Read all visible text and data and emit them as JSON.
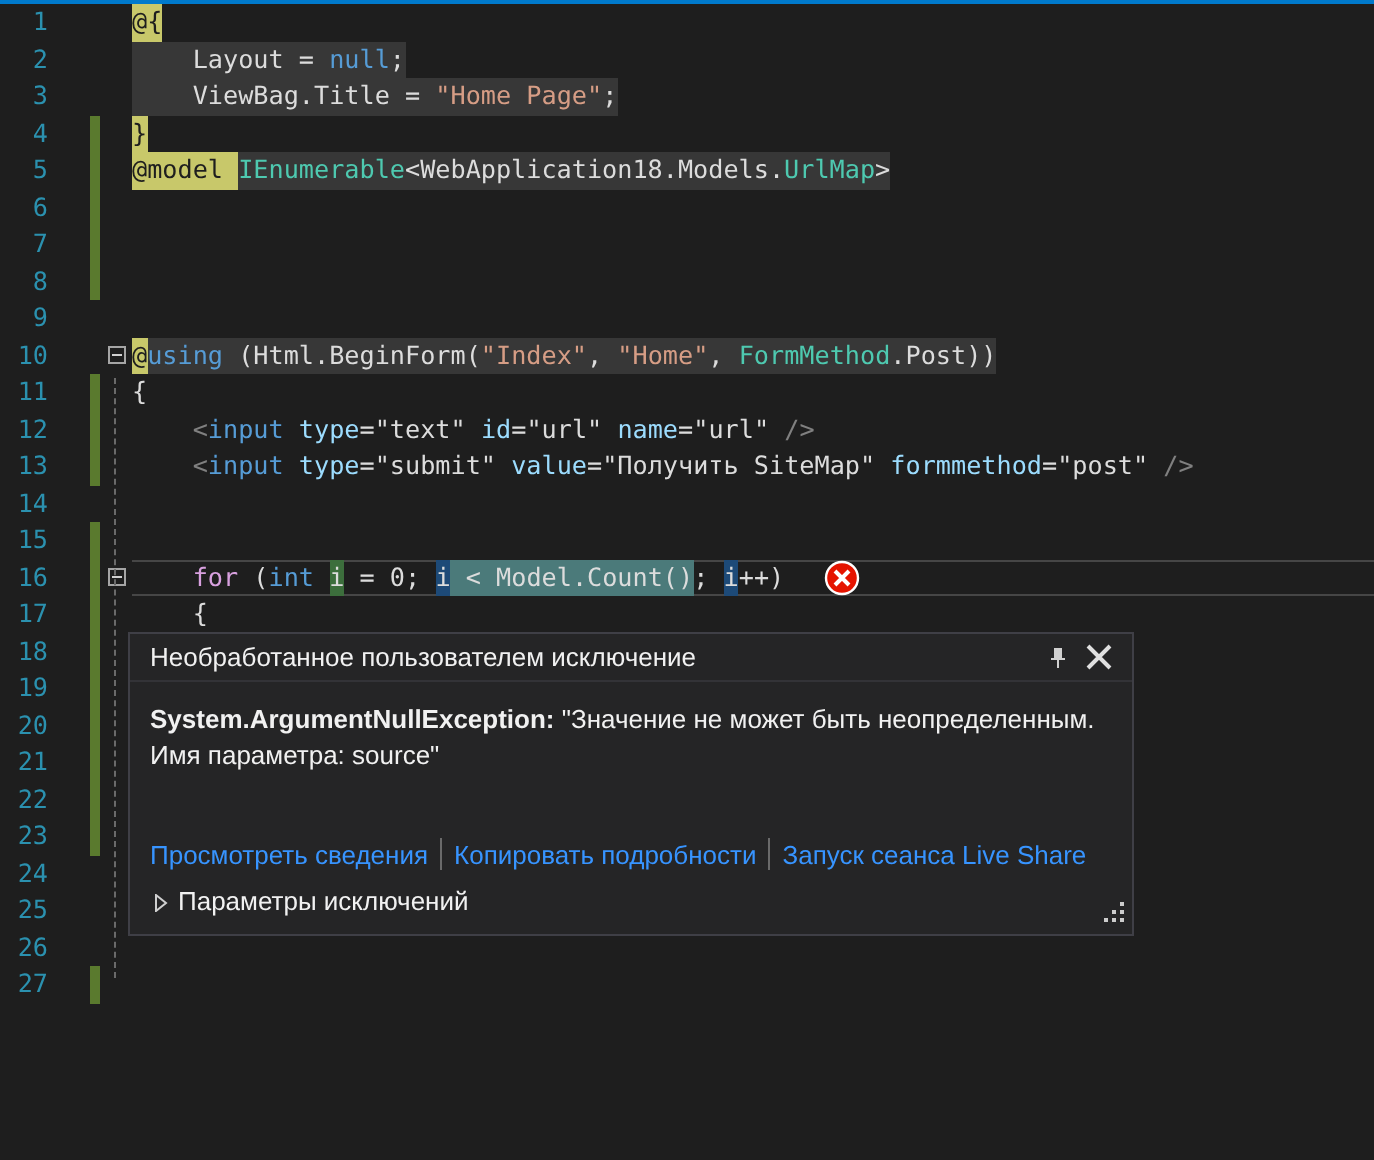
{
  "editor": {
    "lines": [
      {
        "number": "1",
        "modified": false,
        "fold": false,
        "current": false,
        "tokens": [
          {
            "text": "@{",
            "kind": "razor"
          }
        ]
      },
      {
        "number": "2",
        "modified": false,
        "fold": false,
        "current": false,
        "shaded": true,
        "tokens": [
          {
            "text": "    Layout = ",
            "kind": "plain"
          },
          {
            "text": "null",
            "kind": "keyword"
          },
          {
            "text": ";",
            "kind": "plain"
          }
        ]
      },
      {
        "number": "3",
        "modified": false,
        "fold": false,
        "current": false,
        "shaded": true,
        "tokens": [
          {
            "text": "    ViewBag.Title = ",
            "kind": "plain"
          },
          {
            "text": "\"Home Page\"",
            "kind": "string"
          },
          {
            "text": ";",
            "kind": "plain"
          }
        ]
      },
      {
        "number": "4",
        "modified": true,
        "fold": false,
        "current": false,
        "tokens": [
          {
            "text": "}",
            "kind": "razor"
          }
        ]
      },
      {
        "number": "5",
        "modified": true,
        "fold": false,
        "current": false,
        "shaded": true,
        "tokens": [
          {
            "text": "@model ",
            "kind": "razor"
          },
          {
            "text": "IEnumerable",
            "kind": "type"
          },
          {
            "text": "<WebApplication18.Models.",
            "kind": "plain"
          },
          {
            "text": "UrlMap",
            "kind": "type"
          },
          {
            "text": ">",
            "kind": "plain"
          }
        ]
      },
      {
        "number": "6",
        "modified": true,
        "fold": false,
        "current": false
      },
      {
        "number": "7",
        "modified": true,
        "fold": false,
        "current": false
      },
      {
        "number": "8",
        "modified": true,
        "fold": false,
        "current": false
      },
      {
        "number": "9",
        "modified": false,
        "fold": false,
        "current": false
      },
      {
        "number": "10",
        "modified": false,
        "fold": true,
        "current": false,
        "shaded": true,
        "tokens": [
          {
            "text": "@",
            "kind": "razor"
          },
          {
            "text": "using",
            "kind": "keyword"
          },
          {
            "text": " (Html.BeginForm(",
            "kind": "plain"
          },
          {
            "text": "\"Index\"",
            "kind": "string"
          },
          {
            "text": ", ",
            "kind": "plain"
          },
          {
            "text": "\"Home\"",
            "kind": "string"
          },
          {
            "text": ", ",
            "kind": "plain"
          },
          {
            "text": "FormMethod",
            "kind": "type"
          },
          {
            "text": ".Post))",
            "kind": "plain"
          }
        ]
      },
      {
        "number": "11",
        "modified": true,
        "fold": false,
        "current": false,
        "shaded": false,
        "tokens": [
          {
            "text": "{",
            "kind": "plain"
          }
        ]
      },
      {
        "number": "12",
        "modified": true,
        "fold": false,
        "current": false,
        "shaded": false,
        "tokens": [
          {
            "text": "    <",
            "kind": "tag"
          },
          {
            "text": "input ",
            "kind": "keyword"
          },
          {
            "text": "type",
            "kind": "attr"
          },
          {
            "text": "=\"text\" ",
            "kind": "plain"
          },
          {
            "text": "id",
            "kind": "attr"
          },
          {
            "text": "=\"url\" ",
            "kind": "plain"
          },
          {
            "text": "name",
            "kind": "attr"
          },
          {
            "text": "=\"url\" ",
            "kind": "plain"
          },
          {
            "text": "/>",
            "kind": "tag"
          }
        ]
      },
      {
        "number": "13",
        "modified": true,
        "fold": false,
        "current": false,
        "shaded": false,
        "tokens": [
          {
            "text": "    <",
            "kind": "tag"
          },
          {
            "text": "input ",
            "kind": "keyword"
          },
          {
            "text": "type",
            "kind": "attr"
          },
          {
            "text": "=\"submit\" ",
            "kind": "plain"
          },
          {
            "text": "value",
            "kind": "attr"
          },
          {
            "text": "=\"Получить SiteMap\" ",
            "kind": "plain"
          },
          {
            "text": "formmethod",
            "kind": "attr"
          },
          {
            "text": "=\"post\" ",
            "kind": "plain"
          },
          {
            "text": "/>",
            "kind": "tag"
          }
        ]
      },
      {
        "number": "14",
        "modified": false,
        "fold": false,
        "current": false
      },
      {
        "number": "15",
        "modified": true,
        "fold": false,
        "current": false
      },
      {
        "number": "16",
        "modified": true,
        "fold": true,
        "current": true,
        "shaded": false,
        "tokens": [
          {
            "text": "    for",
            "kind": "control"
          },
          {
            "text": " (",
            "kind": "plain"
          },
          {
            "text": "int ",
            "kind": "keyword"
          },
          {
            "text": "i",
            "kind": "ref-write"
          },
          {
            "text": " = 0; ",
            "kind": "plain"
          },
          {
            "text": "i",
            "kind": "ref-read"
          },
          {
            "text": " < Model.Count()",
            "kind": "highlight"
          },
          {
            "text": "; ",
            "kind": "plain"
          },
          {
            "text": "i",
            "kind": "ref-read"
          },
          {
            "text": "++)",
            "kind": "plain"
          }
        ]
      },
      {
        "number": "17",
        "modified": true,
        "fold": false,
        "current": false,
        "shaded": false,
        "tokens": [
          {
            "text": "    {",
            "kind": "plain"
          }
        ]
      },
      {
        "number": "18",
        "modified": true,
        "fold": false,
        "current": false
      },
      {
        "number": "19",
        "modified": true,
        "fold": false,
        "current": false
      },
      {
        "number": "20",
        "modified": true,
        "fold": false,
        "current": false
      },
      {
        "number": "21",
        "modified": true,
        "fold": false,
        "current": false
      },
      {
        "number": "22",
        "modified": true,
        "fold": false,
        "current": false
      },
      {
        "number": "23",
        "modified": true,
        "fold": false,
        "current": false
      },
      {
        "number": "24",
        "modified": false,
        "fold": false,
        "current": false
      },
      {
        "number": "25",
        "modified": false,
        "fold": false,
        "current": false
      },
      {
        "number": "26",
        "modified": false,
        "fold": false,
        "current": false
      },
      {
        "number": "27",
        "modified": true,
        "fold": false,
        "current": false
      }
    ]
  },
  "exception_popup": {
    "title": "Необработанное пользователем исключение",
    "message": "**System.ArgumentNullException:** \"Значение не может быть неопределенным.\nИмя параметра: source\"",
    "links": [
      "Просмотреть сведения",
      "Копировать подробности",
      "Запуск сеанса Live Share"
    ],
    "settings": {
      "label": "Параметры исключений",
      "expanded": false
    }
  }
}
